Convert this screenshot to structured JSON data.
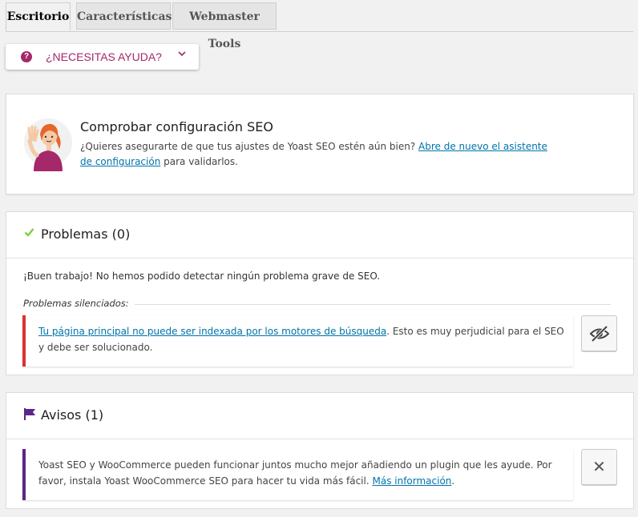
{
  "tabs": [
    {
      "label": "Escritorio",
      "active": true
    },
    {
      "label": "Características",
      "active": false
    },
    {
      "label": "Webmaster Tools",
      "active": false
    }
  ],
  "help": {
    "label": "¿NECESITAS AYUDA?",
    "icon": "question-circle-icon",
    "chevron": "chevron-down-icon",
    "color": "#a4286a"
  },
  "config_card": {
    "title": "Comprobar configuración SEO",
    "text_before": "¿Quieres asegurarte de que tus ajustes de Yoast SEO estén aún bien? ",
    "link": "Abre de nuevo el asistente de configuración",
    "text_after": " para validarlos."
  },
  "problems": {
    "title": "Problemas (0)",
    "icon": "checkmark-icon",
    "good_message": "¡Buen trabajo! No hemos podido detectar ningún problema grave de SEO.",
    "silenced_label": "Problemas silenciados:",
    "notice_link": "Tu página principal no puede ser indexada por los motores de búsqueda",
    "notice_text": ". Esto es muy perjudicial para el SEO y debe ser solucionado.",
    "accent": "#dc3232"
  },
  "warnings": {
    "title": "Avisos (1)",
    "icon": "flag-icon",
    "notice_text": "Yoast SEO y WooCommerce pueden funcionar juntos mucho mejor añadiendo un plugin que les ayude. Por favor, instala Yoast WooCommerce SEO para hacer tu vida más fácil. ",
    "notice_link": "Más información",
    "notice_end": ".",
    "dismiss": "✕",
    "accent": "#5b2788"
  }
}
